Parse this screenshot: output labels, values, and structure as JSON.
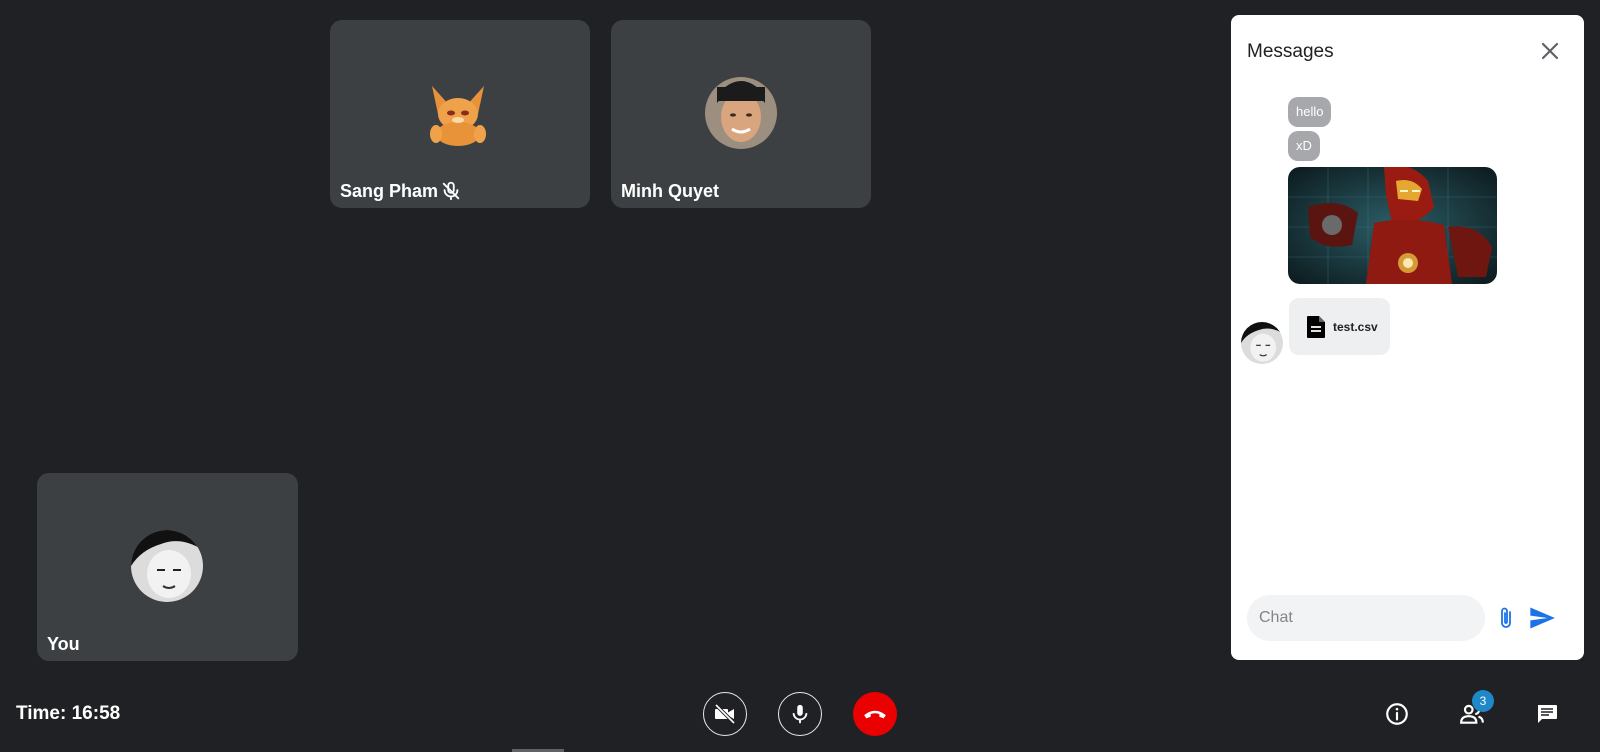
{
  "participants": {
    "sang": {
      "name": "Sang Pham",
      "muted": true
    },
    "minh": {
      "name": "Minh Quyet"
    },
    "you": {
      "name": "You"
    }
  },
  "messages_panel": {
    "title": "Messages",
    "messages": [
      "hello",
      "xD"
    ],
    "file": {
      "name": "test.csv"
    },
    "input_placeholder": "Chat"
  },
  "bottom_bar": {
    "time": "Time: 16:58",
    "participants_badge": "3"
  },
  "colors": {
    "background": "#202124",
    "tile": "#3c4043",
    "hangup": "#ea0000",
    "send": "#1a73e8"
  }
}
